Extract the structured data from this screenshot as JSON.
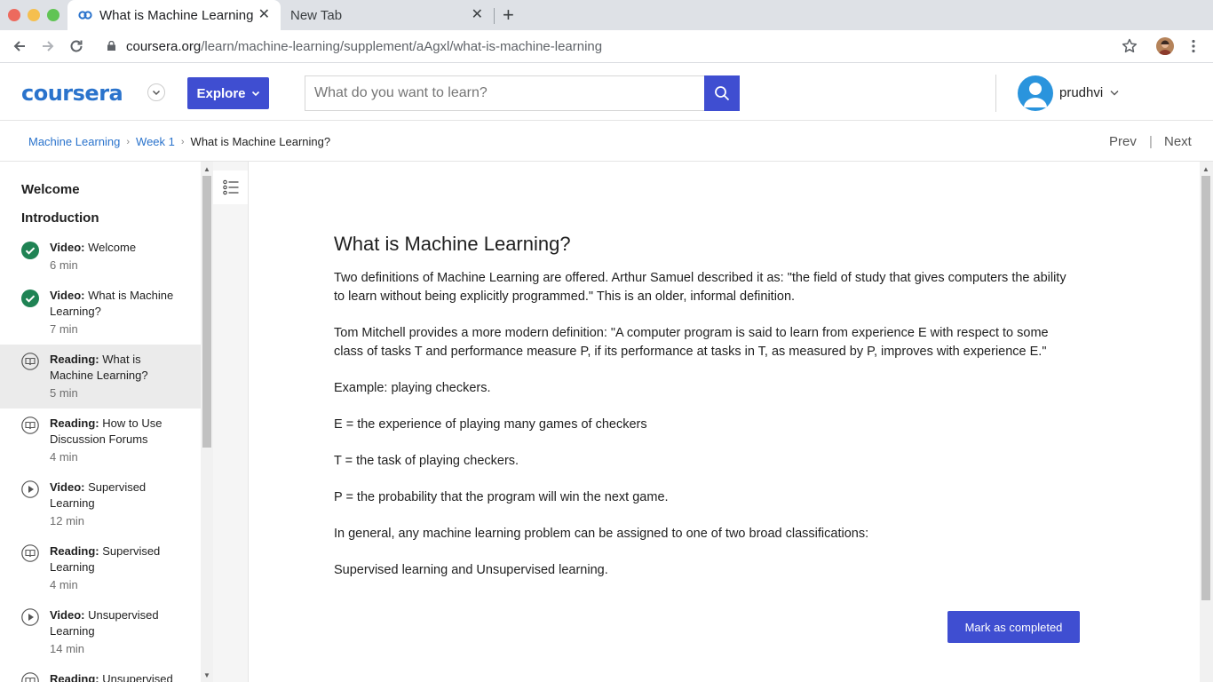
{
  "browser": {
    "tabs": [
      {
        "title": "What is Machine Learning",
        "active": true
      },
      {
        "title": "New Tab",
        "active": false
      }
    ],
    "url_host": "coursera.org",
    "url_path": "/learn/machine-learning/supplement/aAgxl/what-is-machine-learning"
  },
  "header": {
    "logo": "coursera",
    "explore_label": "Explore",
    "search_placeholder": "What do you want to learn?",
    "username": "prudhvi"
  },
  "breadcrumb": {
    "items": [
      "Machine Learning",
      "Week 1",
      "What is Machine Learning?"
    ],
    "prev_label": "Prev",
    "next_label": "Next"
  },
  "sidebar": {
    "sections": [
      "Welcome",
      "Introduction"
    ],
    "lessons": [
      {
        "type": "Video:",
        "title": "Welcome",
        "duration": "6 min",
        "status": "completed"
      },
      {
        "type": "Video:",
        "title": "What is Machine Learning?",
        "duration": "7 min",
        "status": "completed"
      },
      {
        "type": "Reading:",
        "title": "What is Machine Learning?",
        "duration": "5 min",
        "status": "reading",
        "selected": true
      },
      {
        "type": "Reading:",
        "title": "How to Use Discussion Forums",
        "duration": "4 min",
        "status": "reading"
      },
      {
        "type": "Video:",
        "title": "Supervised Learning",
        "duration": "12 min",
        "status": "video"
      },
      {
        "type": "Reading:",
        "title": "Supervised Learning",
        "duration": "4 min",
        "status": "reading"
      },
      {
        "type": "Video:",
        "title": "Unsupervised Learning",
        "duration": "14 min",
        "status": "video"
      },
      {
        "type": "Reading:",
        "title": "Unsupervised",
        "duration": "",
        "status": "reading"
      }
    ]
  },
  "reading": {
    "title": "What is Machine Learning?",
    "paragraphs": [
      "Two definitions of Machine Learning are offered. Arthur Samuel described it as: \"the field of study that gives computers the ability to learn without being explicitly programmed.\" This is an older, informal definition.",
      "Tom Mitchell provides a more modern definition: \"A computer program is said to learn from experience E with respect to some class of tasks T and performance measure P, if its performance at tasks in T, as measured by P, improves with experience E.\"",
      "Example: playing checkers.",
      "E = the experience of playing many games of checkers",
      "T = the task of playing checkers.",
      "P = the probability that the program will win the next game.",
      "In general, any machine learning problem can be assigned to one of two broad classifications:",
      "Supervised learning and Unsupervised learning."
    ],
    "mark_completed_label": "Mark as completed"
  },
  "colors": {
    "brand_blue": "#2a73cc",
    "button_indigo": "#3f4ed1",
    "completed_green": "#1f8354"
  }
}
